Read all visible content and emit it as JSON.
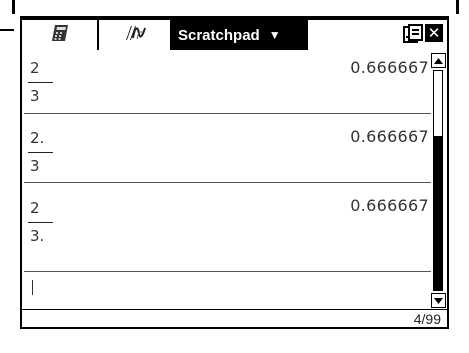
{
  "app": {
    "active_tab": "Scratchpad",
    "active_tab_menu_icon": "dropdown-triangle-icon"
  },
  "tabs": [
    {
      "icon": "calculator-tab-icon"
    },
    {
      "icon": "graph-tab-icon"
    }
  ],
  "entries": [
    {
      "numerator": "2",
      "denominator": "3",
      "result": "0.666667"
    },
    {
      "numerator": "2.",
      "denominator": "3",
      "result": "0.666667"
    },
    {
      "numerator": "2",
      "denominator": "3.",
      "result": "0.666667"
    }
  ],
  "input": {
    "cursor": "|"
  },
  "status": {
    "page_count": "4/99"
  },
  "colors": {
    "tab_bar": "#000000",
    "text": "#333333"
  }
}
